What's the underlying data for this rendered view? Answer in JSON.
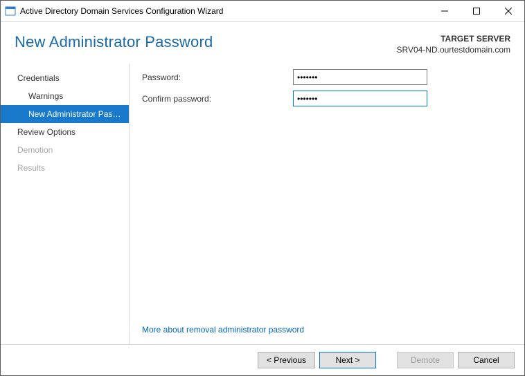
{
  "window": {
    "title": "Active Directory Domain Services Configuration Wizard"
  },
  "header": {
    "title": "New Administrator Password",
    "target_label": "TARGET SERVER",
    "target_value": "SRV04-ND.ourtestdomain.com"
  },
  "sidebar": {
    "steps": [
      {
        "label": "Credentials",
        "indent": false,
        "selected": false,
        "disabled": false
      },
      {
        "label": "Warnings",
        "indent": true,
        "selected": false,
        "disabled": false
      },
      {
        "label": "New Administrator Passw...",
        "indent": true,
        "selected": true,
        "disabled": false
      },
      {
        "label": "Review Options",
        "indent": false,
        "selected": false,
        "disabled": false
      },
      {
        "label": "Demotion",
        "indent": false,
        "selected": false,
        "disabled": true
      },
      {
        "label": "Results",
        "indent": false,
        "selected": false,
        "disabled": true
      }
    ]
  },
  "form": {
    "password_label": "Password:",
    "password_value": "•••••••",
    "confirm_label": "Confirm password:",
    "confirm_value": "•••••••"
  },
  "link": {
    "more_label": "More about removal administrator password"
  },
  "footer": {
    "previous": "< Previous",
    "next": "Next >",
    "demote": "Demote",
    "cancel": "Cancel",
    "demote_enabled": false
  }
}
